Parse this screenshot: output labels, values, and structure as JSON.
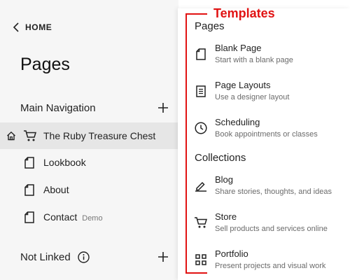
{
  "back_link": {
    "label": "HOME"
  },
  "page_title": "Pages",
  "main_navigation": {
    "label": "Main Navigation",
    "items": [
      {
        "label": "The Ruby Treasure Chest",
        "badge": ""
      },
      {
        "label": "Lookbook",
        "badge": ""
      },
      {
        "label": "About",
        "badge": ""
      },
      {
        "label": "Contact",
        "badge": "Demo"
      }
    ]
  },
  "not_linked": {
    "label": "Not Linked"
  },
  "annotation": {
    "label": "Templates",
    "color": "#e11313"
  },
  "templates": {
    "pages_heading": "Pages",
    "pages": [
      {
        "title": "Blank Page",
        "description": "Start with a blank page",
        "icon": "blank-page-icon"
      },
      {
        "title": "Page Layouts",
        "description": "Use a designer layout",
        "icon": "page-layouts-icon"
      },
      {
        "title": "Scheduling",
        "description": "Book appointments or classes",
        "icon": "clock-icon"
      }
    ],
    "collections_heading": "Collections",
    "collections": [
      {
        "title": "Blog",
        "description": "Share stories, thoughts, and ideas",
        "icon": "pen-icon"
      },
      {
        "title": "Store",
        "description": "Sell products and services online",
        "icon": "cart-icon"
      },
      {
        "title": "Portfolio",
        "description": "Present projects and visual work",
        "icon": "grid-icon"
      }
    ]
  }
}
